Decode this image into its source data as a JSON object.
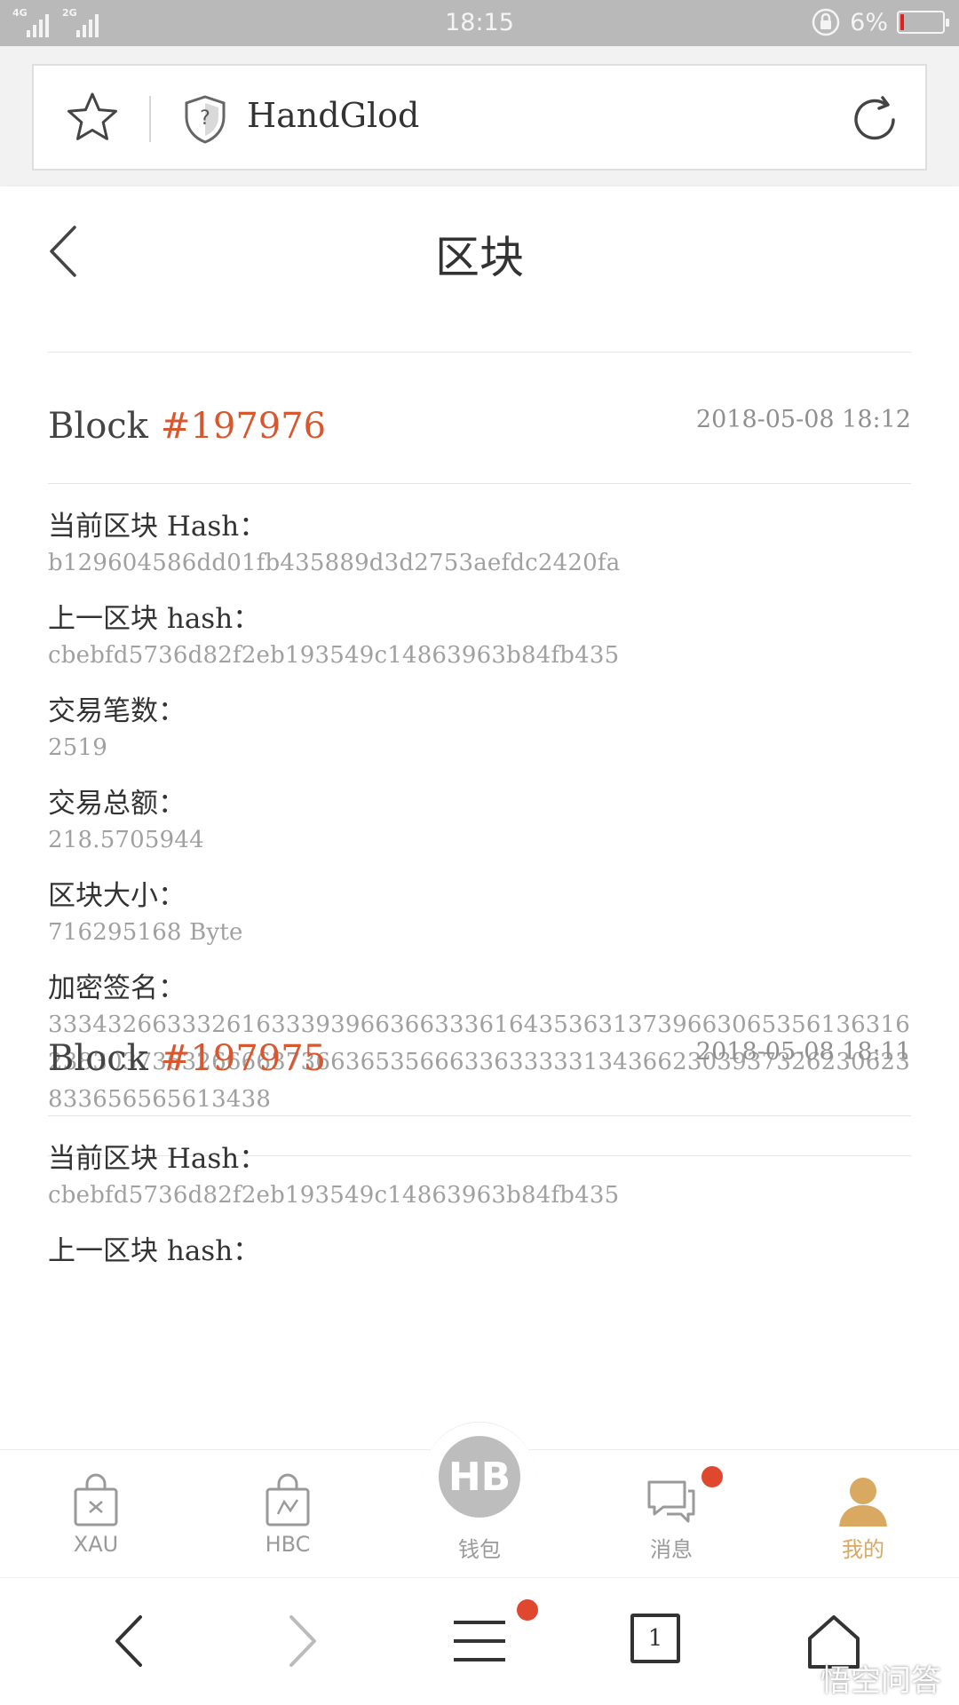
{
  "status_bar": {
    "network_1": "4G",
    "network_2": "2G",
    "time": "18:15",
    "battery_percent": "6%",
    "battery_level": 0.06,
    "battery_color": "#e02020"
  },
  "browser": {
    "url_title": "HandGlod",
    "bookmark_icon": "star-icon",
    "security_icon": "shield-question-icon",
    "reload_icon": "reload-icon"
  },
  "header": {
    "title": "区块",
    "back_icon": "chevron-left-icon"
  },
  "blocks": [
    {
      "label": "Block",
      "number": "#197976",
      "time": "2018-05-08 18:12",
      "fields": [
        {
          "label": "当前区块 Hash：",
          "value": "b129604586dd01fb435889d3d2753aefdc2420fa"
        },
        {
          "label": "上一区块 hash：",
          "value": "cbebfd5736d82f2eb193549c14863963b84fb435"
        },
        {
          "label": "交易笔数：",
          "value": "2519"
        },
        {
          "label": "交易总额：",
          "value": "218.5705944"
        },
        {
          "label": "区块大小：",
          "value": "716295168 Byte"
        },
        {
          "label": "加密签名：",
          "value": "3334326633326163339396636633361643536313739663065356136316238303736326666373663653566633633333134366230393732623062383365656561343​8"
        }
      ]
    },
    {
      "label": "Block",
      "number": "#197975",
      "time": "2018-05-08 18:11",
      "fields": [
        {
          "label": "当前区块 Hash：",
          "value": "cbebfd5736d82f2eb193549c14863963b84fb435"
        },
        {
          "label": "上一区块 hash：",
          "value": ""
        }
      ]
    }
  ],
  "tabs": [
    {
      "label": "XAU",
      "icon": "bag-x-icon"
    },
    {
      "label": "HBC",
      "icon": "bag-chart-icon"
    },
    {
      "label": "钱包",
      "icon": "hb-logo-icon",
      "logo_text": "HB"
    },
    {
      "label": "消息",
      "icon": "chat-icon"
    },
    {
      "label": "我的",
      "icon": "user-icon"
    }
  ],
  "colors": {
    "accent": "#d9572f",
    "active_tab": "#d9a861",
    "badge": "#e0472f"
  },
  "nav": {
    "tab_count": "1"
  },
  "watermark": {
    "text": "悟空问答"
  }
}
